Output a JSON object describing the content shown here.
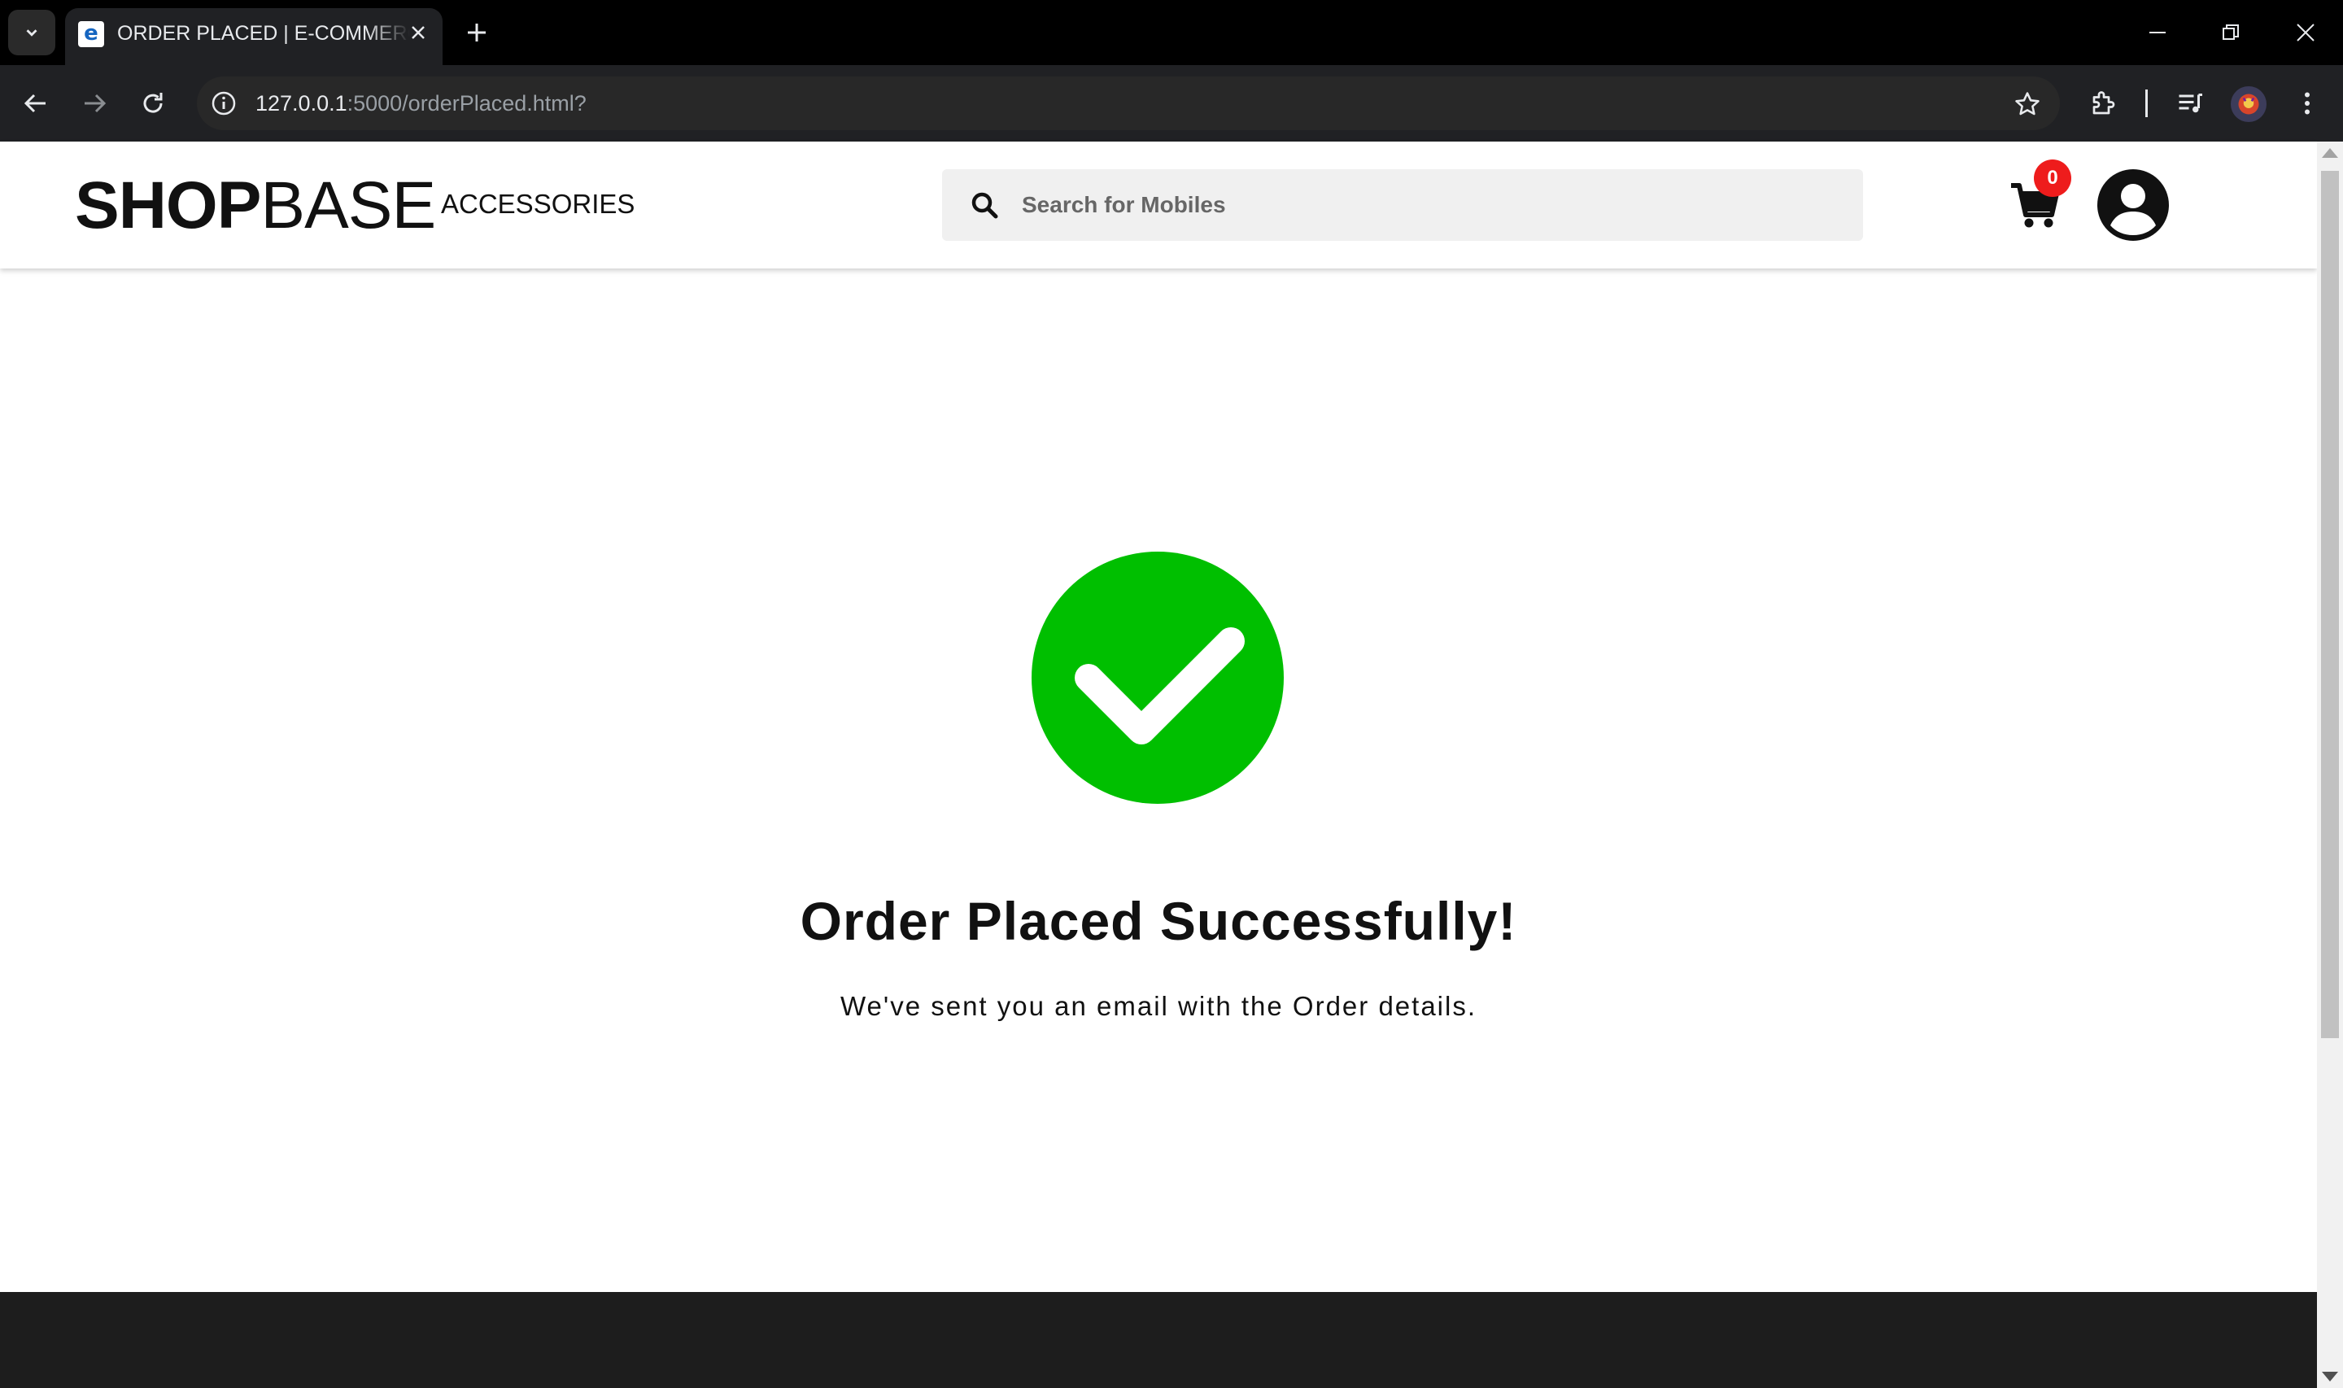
{
  "browser": {
    "tab_title": "ORDER PLACED | E-COMMERCE",
    "tab_favicon": "e",
    "url_host": "127.0.0.1",
    "url_rest": ":5000/orderPlaced.html?"
  },
  "header": {
    "logo_bold": "SHOP",
    "logo_light": "BASE",
    "nav_link": "ACCESSORIES",
    "search_placeholder": "Search for Mobiles",
    "cart_count": "0"
  },
  "main": {
    "title": "Order Placed Successfully!",
    "message": "We've sent you an email with the Order details."
  },
  "colors": {
    "success": "#00bf00",
    "badge": "#ee1c1c",
    "footer": "#1d1d1d"
  }
}
